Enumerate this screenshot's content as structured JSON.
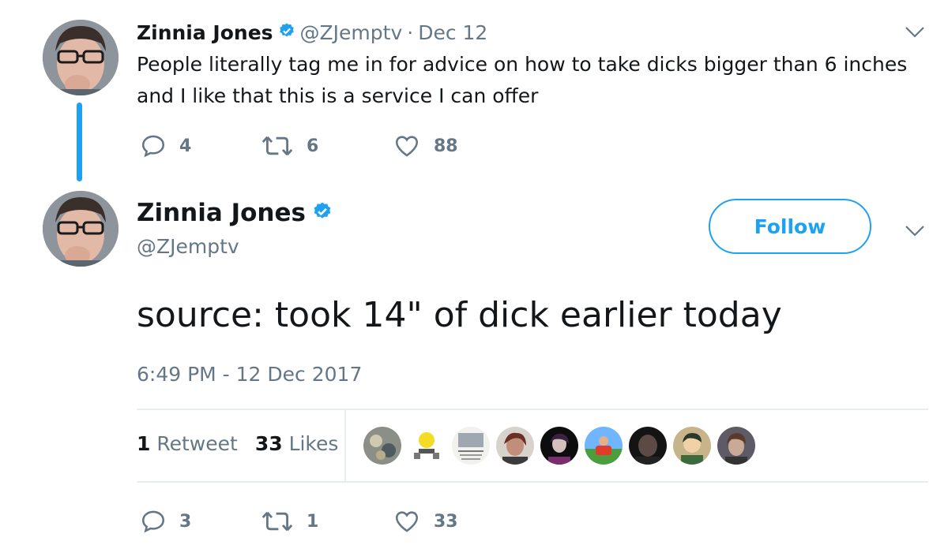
{
  "tweet1": {
    "name": "Zinnia Jones",
    "handle": "@ZJemptv",
    "separator": "·",
    "date": "Dec 12",
    "text_line1": "People literally tag me in for advice on how to take dicks bigger than 6 inches",
    "text_line2": "and I like that this is a service I can offer",
    "replies": "4",
    "retweets": "6",
    "likes": "88"
  },
  "tweet2": {
    "name": "Zinnia Jones",
    "handle": "@ZJemptv",
    "follow_label": "Follow",
    "text": "source: took 14\" of dick earlier today",
    "timestamp": "6:49 PM - 12 Dec 2017",
    "retweet_count": "1",
    "retweet_label": "Retweet",
    "like_count": "33",
    "like_label": "Likes",
    "replies": "3",
    "retweets": "1",
    "likes": "33"
  },
  "colors": {
    "accent": "#1da1f2",
    "muted": "#657786",
    "text": "#14171a",
    "divider": "#e6ecf0"
  },
  "icons": [
    "verified-badge-icon",
    "chevron-down-icon",
    "reply-icon",
    "retweet-icon",
    "like-icon"
  ]
}
